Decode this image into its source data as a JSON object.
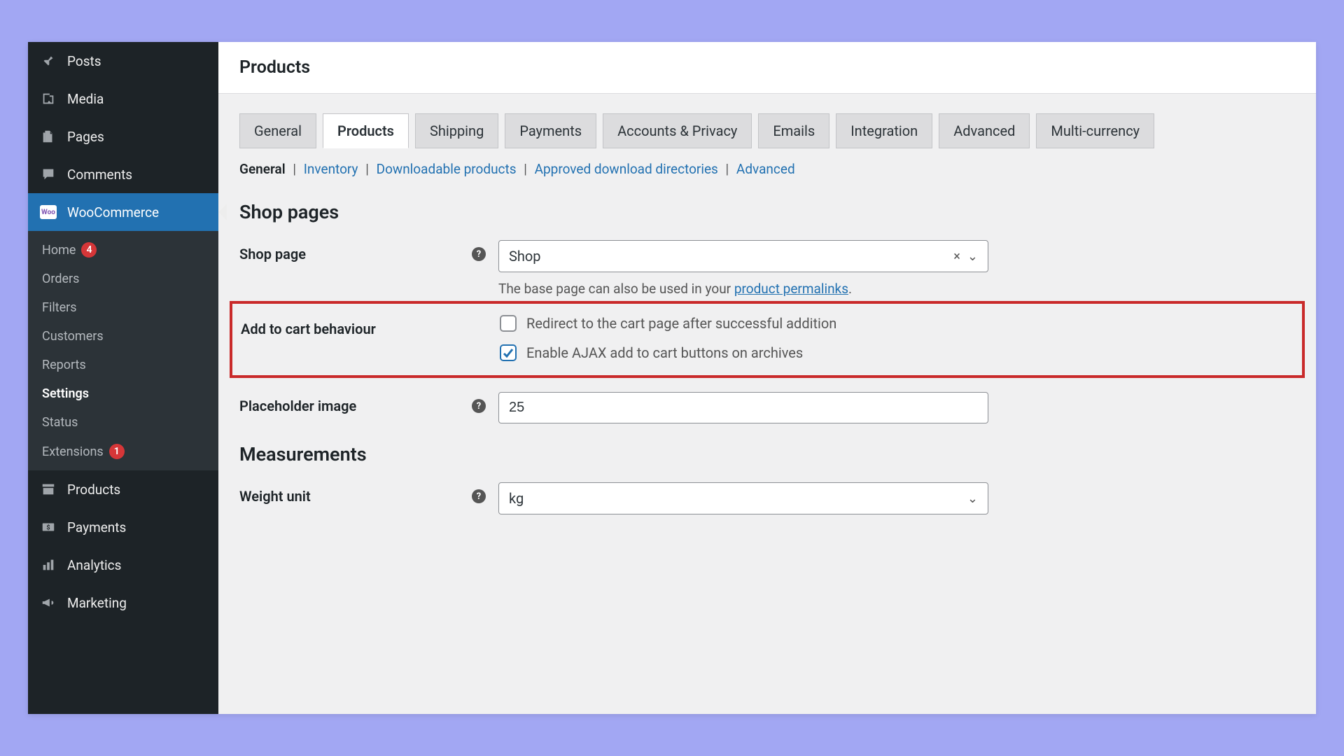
{
  "sidebar": {
    "top": [
      {
        "label": "Posts",
        "icon": "pin"
      },
      {
        "label": "Media",
        "icon": "media"
      },
      {
        "label": "Pages",
        "icon": "pages"
      },
      {
        "label": "Comments",
        "icon": "comment"
      }
    ],
    "active": {
      "label": "WooCommerce"
    },
    "sub": [
      {
        "label": "Home",
        "badge": "4"
      },
      {
        "label": "Orders"
      },
      {
        "label": "Filters"
      },
      {
        "label": "Customers"
      },
      {
        "label": "Reports"
      },
      {
        "label": "Settings",
        "bold": true
      },
      {
        "label": "Status"
      },
      {
        "label": "Extensions",
        "badge": "1"
      }
    ],
    "bottom": [
      {
        "label": "Products",
        "icon": "archive"
      },
      {
        "label": "Payments",
        "icon": "dollar"
      },
      {
        "label": "Analytics",
        "icon": "bars"
      },
      {
        "label": "Marketing",
        "icon": "megaphone"
      }
    ]
  },
  "header": {
    "title": "Products"
  },
  "tabs": [
    "General",
    "Products",
    "Shipping",
    "Payments",
    "Accounts & Privacy",
    "Emails",
    "Integration",
    "Advanced",
    "Multi-currency"
  ],
  "activeTab": "Products",
  "subtabs": [
    "General",
    "Inventory",
    "Downloadable products",
    "Approved download directories",
    "Advanced"
  ],
  "activeSubtab": "General",
  "sections": {
    "shop_pages": "Shop pages",
    "measurements": "Measurements"
  },
  "fields": {
    "shop_page": {
      "label": "Shop page",
      "value": "Shop",
      "desc_pre": "The base page can also be used in your ",
      "desc_link": "product permalinks",
      "desc_post": "."
    },
    "add_to_cart": {
      "label": "Add to cart behaviour",
      "opt1": "Redirect to the cart page after successful addition",
      "opt2": "Enable AJAX add to cart buttons on archives",
      "checked1": false,
      "checked2": true
    },
    "placeholder_image": {
      "label": "Placeholder image",
      "value": "25"
    },
    "weight_unit": {
      "label": "Weight unit",
      "value": "kg"
    }
  }
}
